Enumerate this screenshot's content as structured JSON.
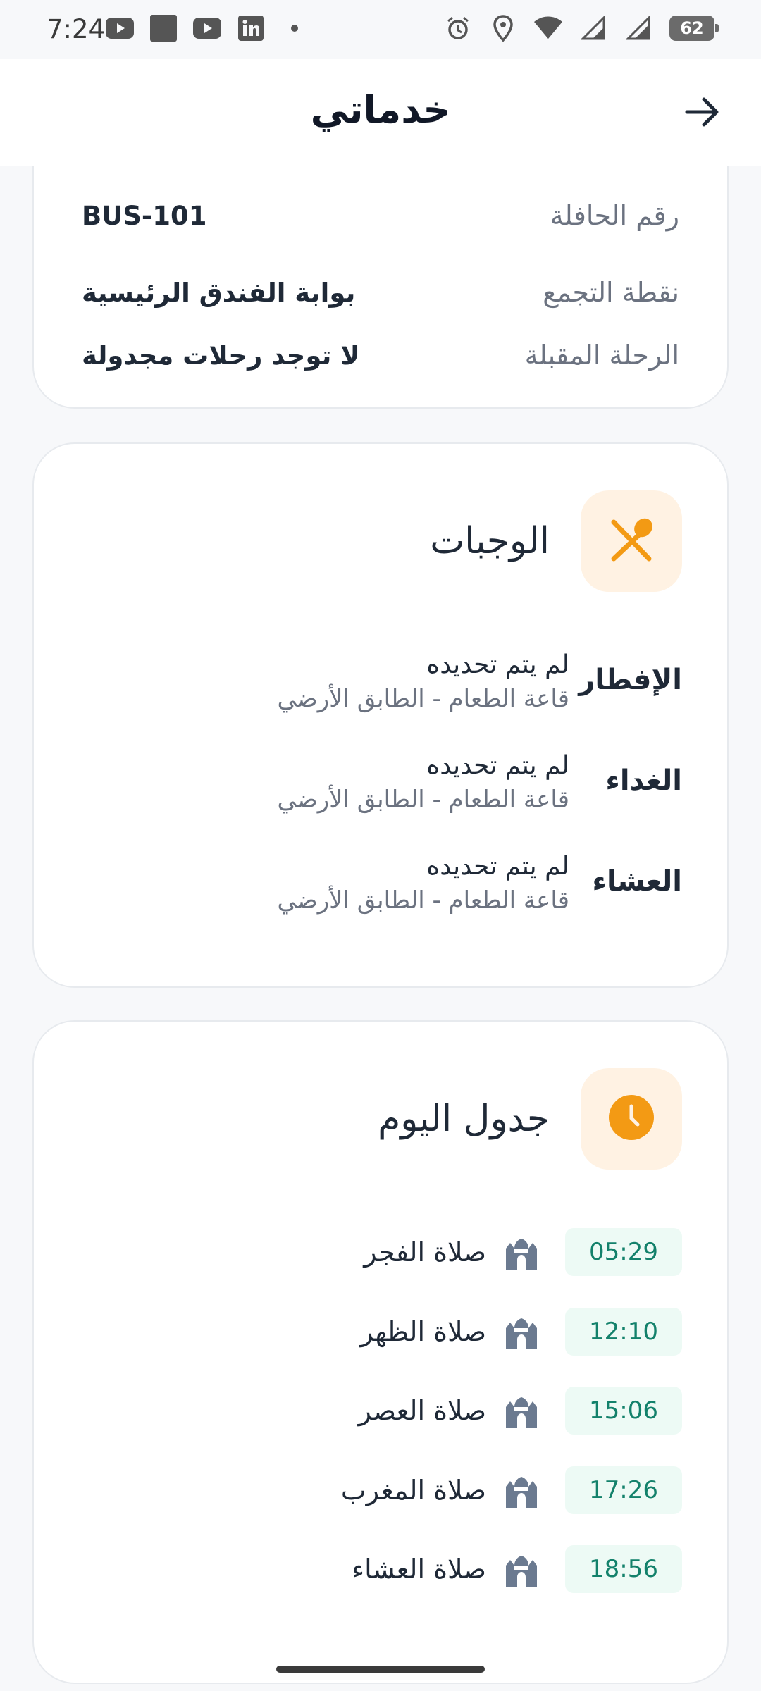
{
  "status_bar": {
    "time": "7:24",
    "left_icons": [
      "youtube-icon",
      "square-icon",
      "youtube-icon",
      "linkedin-icon",
      "dot-icon"
    ],
    "right_icons": [
      "alarm-icon",
      "location-icon",
      "wifi-icon",
      "signal-icon",
      "signal-icon"
    ],
    "battery": "62"
  },
  "header": {
    "title": "خدماتي",
    "back_icon": "arrow-right-icon"
  },
  "transport": {
    "rows": [
      {
        "label": "رقم الحافلة",
        "value": "BUS-101"
      },
      {
        "label": "نقطة التجمع",
        "value": "بوابة الفندق الرئيسية"
      },
      {
        "label": "الرحلة المقبلة",
        "value": "لا توجد رحلات مجدولة"
      }
    ]
  },
  "meals": {
    "title": "الوجبات",
    "icon": "utensils-icon",
    "items": [
      {
        "name": "الإفطار",
        "status": "لم يتم تحديده",
        "place": "قاعة الطعام - الطابق الأرضي"
      },
      {
        "name": "الغداء",
        "status": "لم يتم تحديده",
        "place": "قاعة الطعام - الطابق الأرضي"
      },
      {
        "name": "العشاء",
        "status": "لم يتم تحديده",
        "place": "قاعة الطعام - الطابق الأرضي"
      }
    ]
  },
  "schedule": {
    "title": "جدول اليوم",
    "icon": "clock-icon",
    "items": [
      {
        "name": "صلاة الفجر",
        "time": "05:29"
      },
      {
        "name": "صلاة الظهر",
        "time": "12:10"
      },
      {
        "name": "صلاة العصر",
        "time": "15:06"
      },
      {
        "name": "صلاة المغرب",
        "time": "17:26"
      },
      {
        "name": "صلاة العشاء",
        "time": "18:56"
      }
    ]
  },
  "colors": {
    "accent_orange": "#F39A14",
    "tile_bg": "#FFF2E3",
    "time_text": "#13816B",
    "time_bg": "#EDFAF5",
    "mosque": "#6B7A90"
  }
}
